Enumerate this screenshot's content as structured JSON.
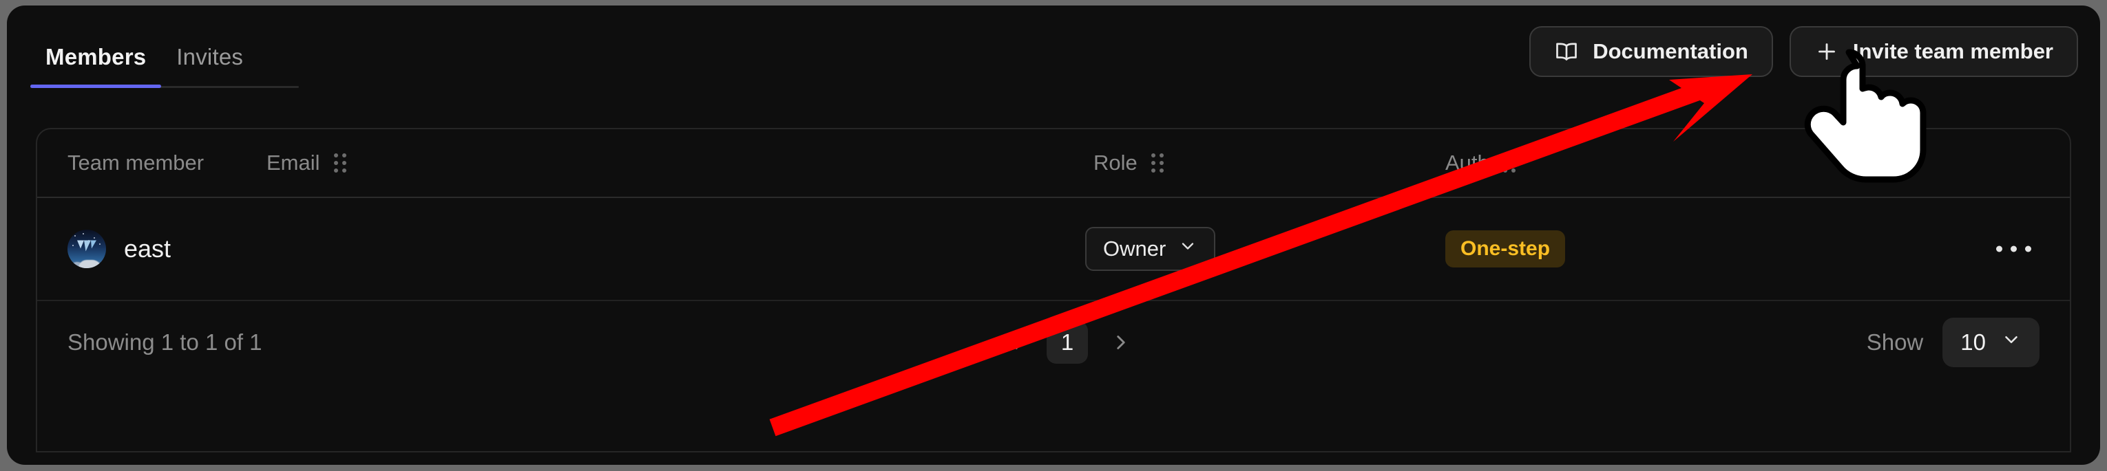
{
  "tabs": [
    {
      "label": "Members",
      "active": true
    },
    {
      "label": "Invites",
      "active": false
    }
  ],
  "actions": {
    "documentation_label": "Documentation",
    "documentation_icon": "book-open-icon",
    "invite_label": "Invite team member",
    "invite_icon": "plus-icon"
  },
  "table": {
    "headers": {
      "team_member": "Team member",
      "email": "Email",
      "role": "Role",
      "auth": "Auth"
    },
    "rows": [
      {
        "name": "east",
        "email": "",
        "role": "Owner",
        "auth_badge": "One-step",
        "avatar": "user-avatar-night-sky",
        "menu_icon": "ellipsis-icon"
      }
    ]
  },
  "footer": {
    "showing": "Showing 1 to 1 of 1",
    "prev_icon": "chevron-left-icon",
    "next_icon": "chevron-right-icon",
    "current_page": "1",
    "show_label": "Show",
    "page_size": "10"
  },
  "colors": {
    "accent": "#6366f1",
    "badge_text": "#fbbf24",
    "badge_bg": "#3a2c0c",
    "panel_bg": "#0e0e0e",
    "page_bg": "#6b6b6b",
    "annotation_arrow": "#ff0000"
  },
  "annotation": {
    "arrow": "red-arrow-pointing-to-invite-team-member-button",
    "cursor": "pointing-hand-cursor"
  }
}
